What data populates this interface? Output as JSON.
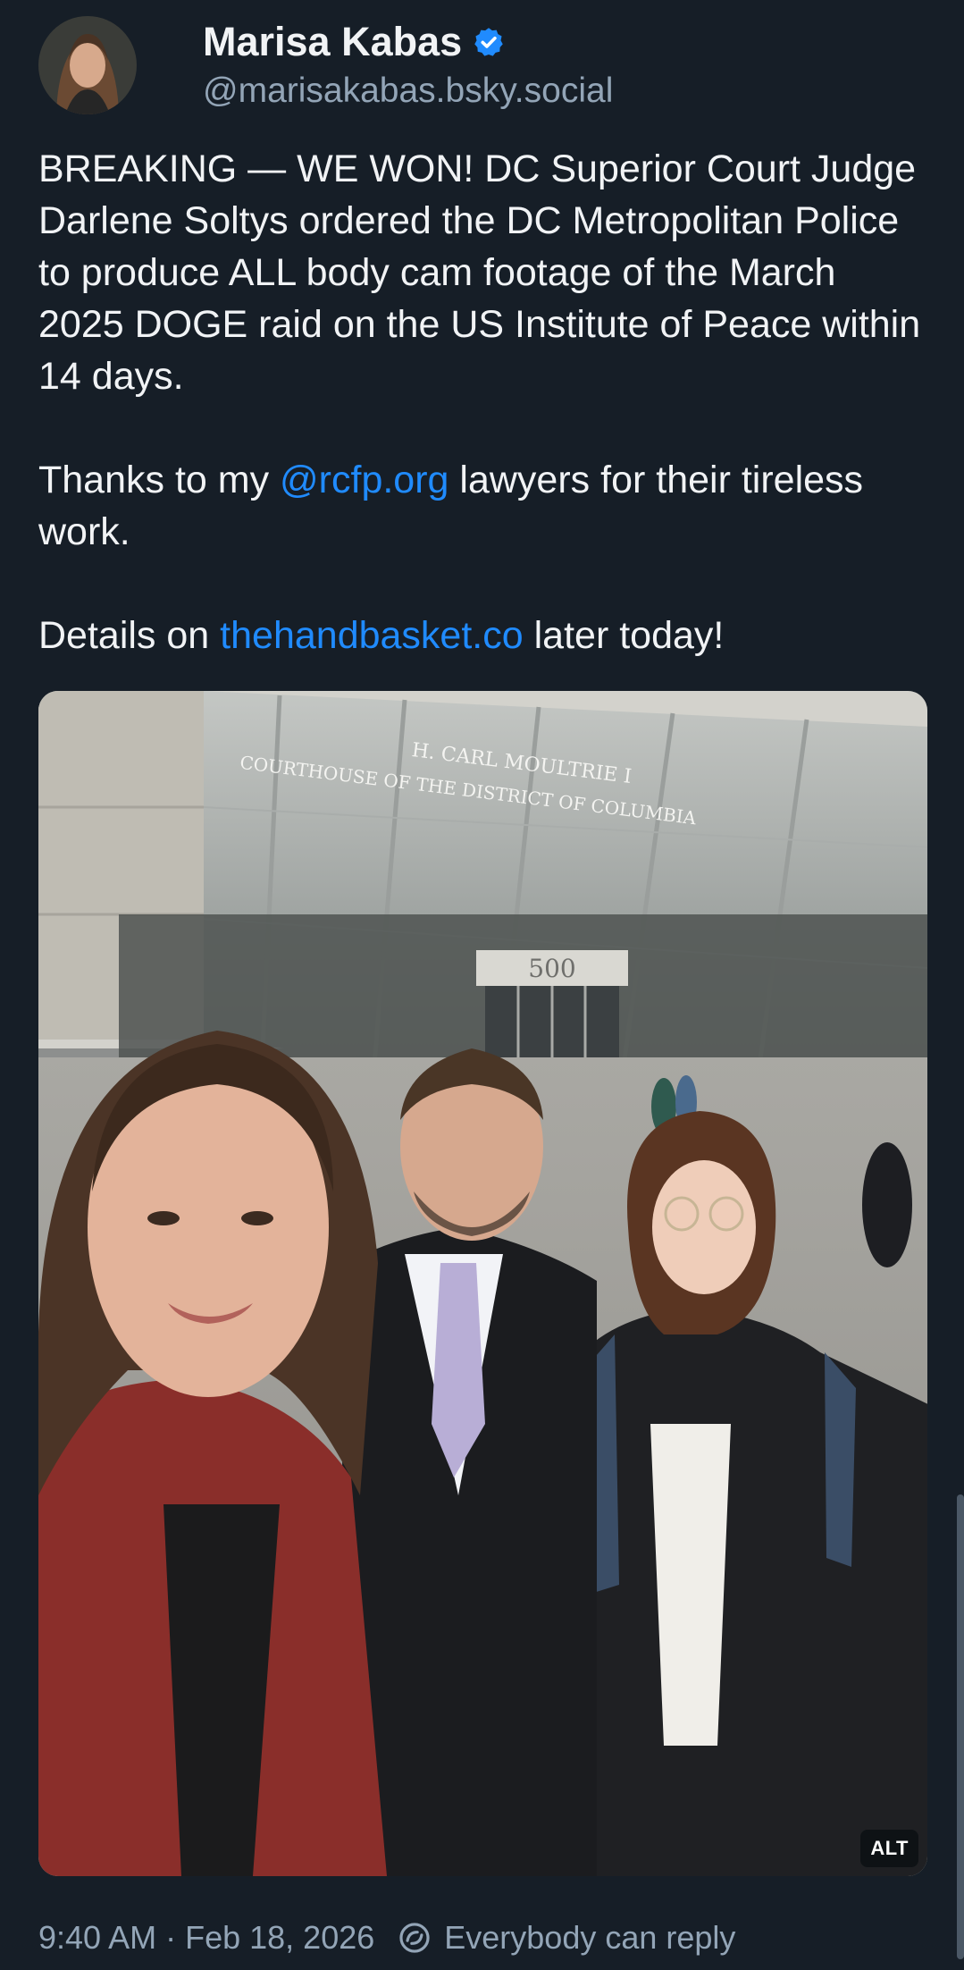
{
  "author": {
    "display_name": "Marisa Kabas",
    "handle": "@marisakabas.bsky.social",
    "verified_icon": "verified-check-icon",
    "verified_color": "#208bfe"
  },
  "post": {
    "paragraph1": "BREAKING — WE WON! DC Superior Court Judge Darlene Soltys ordered the DC Metropolitan Police to produce ALL body cam footage of the March 2025 DOGE raid on the US Institute of Peace within 14 days.",
    "paragraph2_prefix": "Thanks to my ",
    "paragraph2_mention": "@rcfp.org",
    "paragraph2_suffix": " lawyers for their tireless work.",
    "paragraph3_prefix": "Details on ",
    "paragraph3_link": "thehandbasket.co",
    "paragraph3_suffix": " later today!",
    "link_color": "#208bfe"
  },
  "image": {
    "sign_line1": "H. CARL MOULTRIE I",
    "sign_line2": "COURTHOUSE OF THE DISTRICT OF COLUMBIA",
    "building_number": "500",
    "alt_badge": "ALT"
  },
  "footer": {
    "time": "9:40 AM",
    "separator": "·",
    "date": "Feb 18, 2026",
    "reply_icon": "reply-restriction-icon",
    "reply_setting": "Everybody can reply"
  },
  "colors": {
    "background": "#161e27",
    "text": "#f1f3f5",
    "muted": "#93a5b7"
  }
}
